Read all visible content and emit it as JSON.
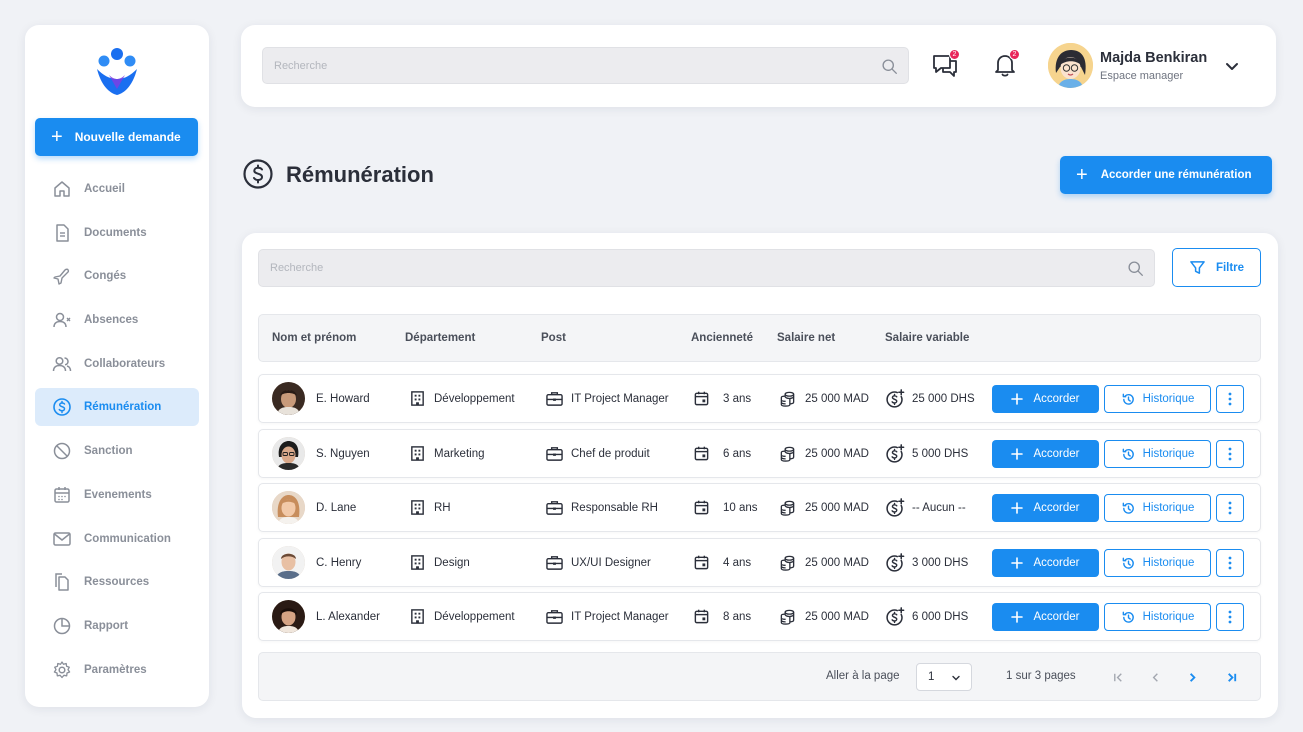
{
  "colors": {
    "accent": "#1a8cf0",
    "badge": "#e8265b",
    "background": "#f0f2f6"
  },
  "sidebar": {
    "new_request_label": "Nouvelle demande",
    "items": [
      {
        "label": "Accueil",
        "icon": "home-icon"
      },
      {
        "label": "Documents",
        "icon": "document-icon"
      },
      {
        "label": "Congés",
        "icon": "plane-icon"
      },
      {
        "label": "Absences",
        "icon": "user-x-icon"
      },
      {
        "label": "Collaborateurs",
        "icon": "users-icon"
      },
      {
        "label": "Rémunération",
        "icon": "dollar-circle-icon",
        "active": true
      },
      {
        "label": "Sanction",
        "icon": "ban-icon"
      },
      {
        "label": "Evenements",
        "icon": "calendar-icon"
      },
      {
        "label": "Communication",
        "icon": "mail-icon"
      },
      {
        "label": "Ressources",
        "icon": "files-icon"
      },
      {
        "label": "Rapport",
        "icon": "pie-chart-icon"
      },
      {
        "label": "Paramètres",
        "icon": "gear-icon"
      }
    ]
  },
  "topbar": {
    "search_placeholder": "Recherche",
    "messages_badge": "2",
    "notifications_badge": "2",
    "user_name": "Majda Benkiran",
    "user_role": "Espace manager"
  },
  "page": {
    "title": "Rémunération",
    "grant_button": "Accorder une rémunération",
    "search_placeholder": "Recherche",
    "filter_label": "Filtre"
  },
  "table": {
    "headers": [
      "Nom et prénom",
      "Département",
      "Post",
      "Ancienneté",
      "Salaire net",
      "Salaire variable"
    ],
    "accorder_label": "Accorder",
    "historique_label": "Historique",
    "rows": [
      {
        "name": "E. Howard",
        "department": "Développement",
        "post": "IT Project Manager",
        "seniority": "3 ans",
        "net": "25 000 MAD",
        "variable": "25 000 DHS"
      },
      {
        "name": "S. Nguyen",
        "department": "Marketing",
        "post": "Chef de produit",
        "seniority": "6 ans",
        "net": "25 000 MAD",
        "variable": "5 000 DHS"
      },
      {
        "name": "D. Lane",
        "department": "RH",
        "post": "Responsable RH",
        "seniority": "10 ans",
        "net": "25 000 MAD",
        "variable": "-- Aucun --"
      },
      {
        "name": "C. Henry",
        "department": "Design",
        "post": "UX/UI Designer",
        "seniority": "4 ans",
        "net": "25 000 MAD",
        "variable": "3 000 DHS"
      },
      {
        "name": "L. Alexander",
        "department": "Développement",
        "post": "IT Project Manager",
        "seniority": "8 ans",
        "net": "25 000 MAD",
        "variable": "6 000 DHS"
      }
    ]
  },
  "pagination": {
    "goto_label": "Aller à la page",
    "current_page": "1",
    "info": "1 sur 3 pages"
  }
}
